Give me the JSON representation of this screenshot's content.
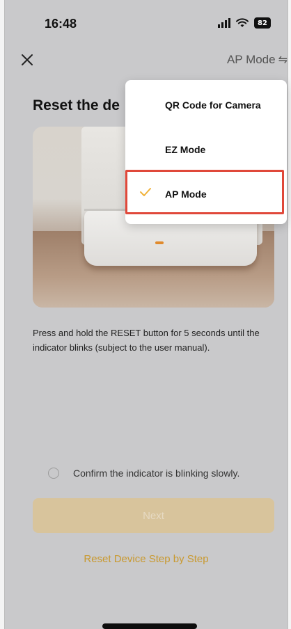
{
  "status_bar": {
    "time": "16:48",
    "battery": "82"
  },
  "header": {
    "mode_label": "AP Mode",
    "swap_glyph": "⇋"
  },
  "page": {
    "title_visible": "Reset the de",
    "instruction": "Press and hold the RESET button for 5 seconds until the indicator blinks (subject to the user manual).",
    "confirm_label": "Confirm the indicator is blinking slowly.",
    "next_button": "Next",
    "reset_link": "Reset Device Step by Step"
  },
  "dropdown": {
    "items": [
      {
        "label": "QR Code for Camera",
        "selected": false
      },
      {
        "label": "EZ Mode",
        "selected": false
      },
      {
        "label": "AP Mode",
        "selected": true
      }
    ]
  },
  "colors": {
    "accent": "#c9992e",
    "check": "#f0b23a",
    "highlight": "#e0483a",
    "next_button_bg": "#d8c49c"
  },
  "icons": {
    "close": "close-icon",
    "swap": "swap-arrows-icon",
    "check": "checkmark-icon",
    "signal": "cellular-signal-icon",
    "wifi": "wifi-icon",
    "battery": "battery-icon"
  }
}
